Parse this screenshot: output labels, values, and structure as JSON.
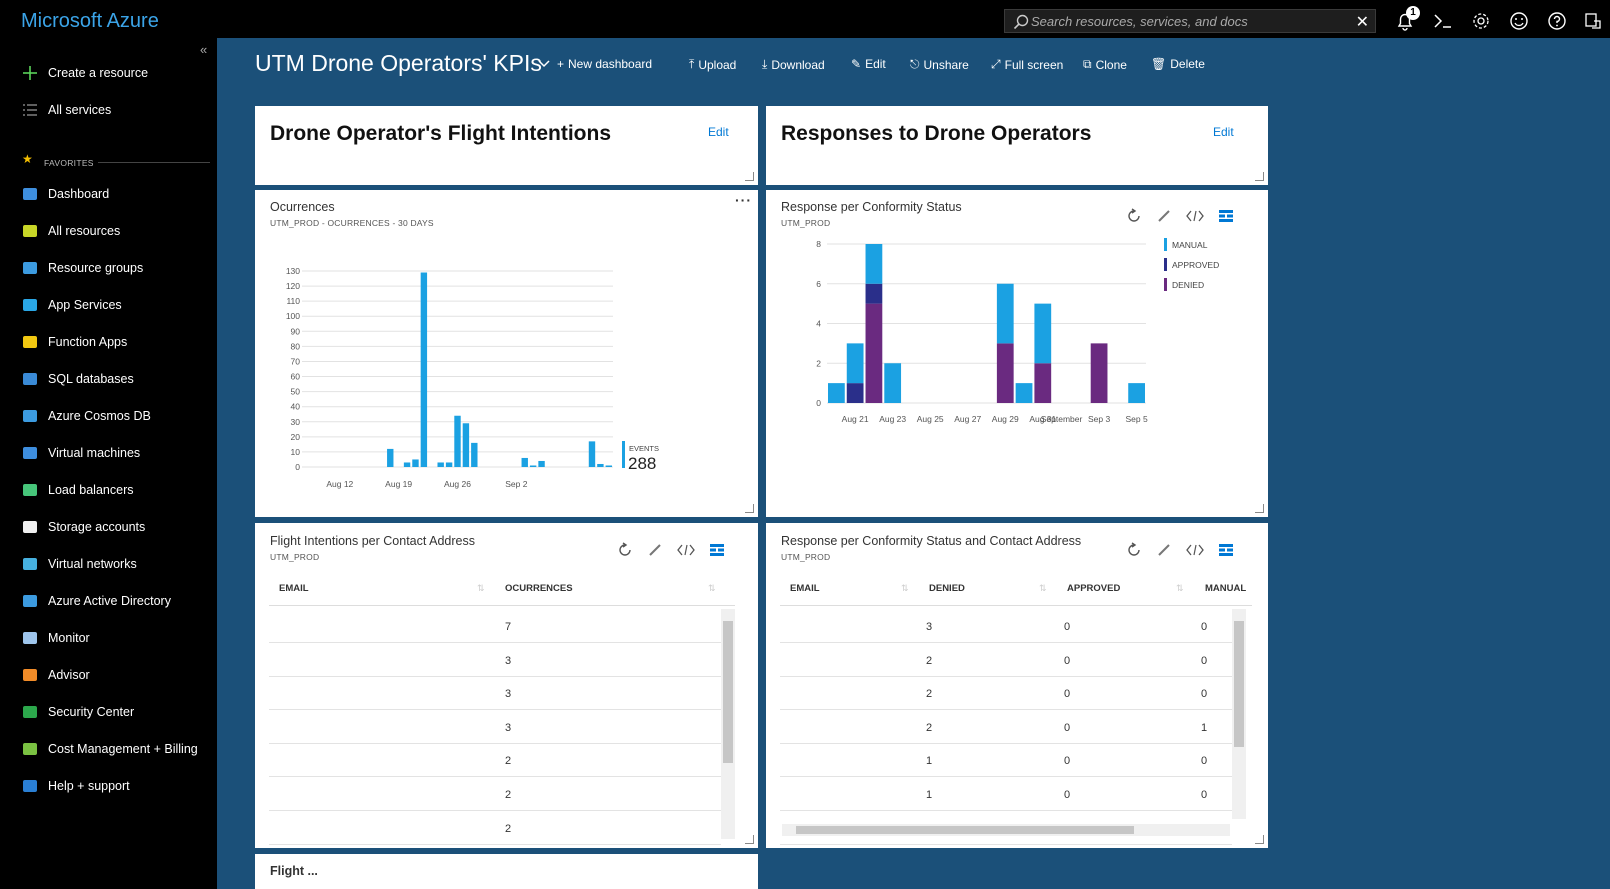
{
  "app": {
    "brand": "Microsoft Azure"
  },
  "topbar": {
    "search_placeholder": "Search resources, services, and docs",
    "notification_count": "1",
    "icons": [
      "bell-icon",
      "cloud-shell-icon",
      "settings-icon",
      "smiley-icon",
      "help-icon",
      "feedback-icon"
    ]
  },
  "sidebar": {
    "create": "Create a resource",
    "all_services": "All services",
    "favorites_label": "FAVORITES",
    "items": [
      {
        "label": "Dashboard",
        "icon": "dashboard-icon"
      },
      {
        "label": "All resources",
        "icon": "all-resources-icon"
      },
      {
        "label": "Resource groups",
        "icon": "resource-groups-icon"
      },
      {
        "label": "App Services",
        "icon": "app-services-icon"
      },
      {
        "label": "Function Apps",
        "icon": "function-apps-icon"
      },
      {
        "label": "SQL databases",
        "icon": "sql-databases-icon"
      },
      {
        "label": "Azure Cosmos DB",
        "icon": "cosmos-db-icon"
      },
      {
        "label": "Virtual machines",
        "icon": "virtual-machines-icon"
      },
      {
        "label": "Load balancers",
        "icon": "load-balancers-icon"
      },
      {
        "label": "Storage accounts",
        "icon": "storage-accounts-icon"
      },
      {
        "label": "Virtual networks",
        "icon": "virtual-networks-icon"
      },
      {
        "label": "Azure Active Directory",
        "icon": "active-directory-icon"
      },
      {
        "label": "Monitor",
        "icon": "monitor-icon"
      },
      {
        "label": "Advisor",
        "icon": "advisor-icon"
      },
      {
        "label": "Security Center",
        "icon": "security-center-icon"
      },
      {
        "label": "Cost Management + Billing",
        "icon": "cost-management-icon"
      },
      {
        "label": "Help + support",
        "icon": "help-support-icon"
      }
    ]
  },
  "dashboard": {
    "title": "UTM Drone Operators' KPIs",
    "toolbar": {
      "new_dashboard": "New dashboard",
      "upload": "Upload",
      "download": "Download",
      "edit": "Edit",
      "unshare": "Unshare",
      "full_screen": "Full screen",
      "clone": "Clone",
      "delete": "Delete"
    }
  },
  "tiles": {
    "md1": {
      "title": "Drone Operator's Flight Intentions",
      "edit": "Edit"
    },
    "md2": {
      "title": "Responses to Drone Operators",
      "edit": "Edit"
    },
    "occurrences": {
      "title": "Ocurrences",
      "subtitle": "UTM_PROD - OCURRENCES - 30 DAYS",
      "total_label": "EVENTS",
      "total": "288"
    },
    "conformity": {
      "title": "Response per Conformity Status",
      "subtitle": "UTM_PROD"
    },
    "contact": {
      "title": "Flight Intentions per Contact Address",
      "subtitle": "UTM_PROD",
      "headers": [
        "EMAIL",
        "OCURRENCES"
      ],
      "rows": [
        [
          "",
          "7"
        ],
        [
          "",
          "3"
        ],
        [
          "",
          "3"
        ],
        [
          "",
          "3"
        ],
        [
          "",
          "2"
        ],
        [
          "",
          "2"
        ],
        [
          "",
          "2"
        ]
      ]
    },
    "conformity_contact": {
      "title": "Response per Conformity Status and Contact Address",
      "subtitle": "UTM_PROD",
      "headers": [
        "EMAIL",
        "DENIED",
        "APPROVED",
        "MANUAL"
      ],
      "rows": [
        [
          "",
          "3",
          "0",
          "0"
        ],
        [
          "",
          "2",
          "0",
          "0"
        ],
        [
          "",
          "2",
          "0",
          "0"
        ],
        [
          "",
          "2",
          "0",
          "1"
        ],
        [
          "",
          "1",
          "0",
          "0"
        ],
        [
          "",
          "1",
          "0",
          "0"
        ],
        [
          "",
          "1",
          "0",
          "0"
        ]
      ]
    },
    "bottom": {
      "title": "Flight ..."
    }
  },
  "colors": {
    "accent": "#1ba1e2",
    "manual": "#1ba1e2",
    "approved": "#2a2f8a",
    "denied": "#6a2a80",
    "dashboard_bg": "#1b5079"
  },
  "chart_data": [
    {
      "type": "bar",
      "title": "Ocurrences",
      "subtitle": "UTM_PROD - OCURRENCES - 30 DAYS",
      "x_tick_labels": [
        "Aug 12",
        "Aug 19",
        "Aug 26",
        "Sep 2"
      ],
      "x_first": "Aug 8",
      "x_last": "Sep 9",
      "days": [
        "Aug 8",
        "Aug 9",
        "Aug 10",
        "Aug 11",
        "Aug 12",
        "Aug 13",
        "Aug 14",
        "Aug 15",
        "Aug 16",
        "Aug 17",
        "Aug 18",
        "Aug 19",
        "Aug 20",
        "Aug 21",
        "Aug 22",
        "Aug 23",
        "Aug 24",
        "Aug 25",
        "Aug 26",
        "Aug 27",
        "Aug 28",
        "Aug 29",
        "Aug 30",
        "Aug 31",
        "Sep 1",
        "Sep 2",
        "Sep 3",
        "Sep 4",
        "Sep 5",
        "Sep 6",
        "Sep 7",
        "Sep 8",
        "Sep 9"
      ],
      "values": [
        0,
        0,
        0,
        0,
        0,
        0,
        0,
        0,
        0,
        0,
        12,
        0,
        3,
        5,
        129,
        0,
        3,
        3,
        34,
        29,
        16,
        0,
        0,
        0,
        0,
        0,
        6,
        1,
        4,
        0,
        0,
        0,
        0,
        0,
        17,
        2,
        1
      ],
      "yticks": [
        0,
        10,
        20,
        30,
        40,
        50,
        60,
        70,
        80,
        90,
        100,
        110,
        120,
        130
      ],
      "ylim": [
        0,
        130
      ],
      "legend": {
        "label": "EVENTS",
        "value": "288"
      }
    },
    {
      "type": "bar",
      "stacked": true,
      "title": "Response per Conformity Status",
      "subtitle": "UTM_PROD",
      "x_tick_labels": [
        "Aug 21",
        "Aug 23",
        "Aug 25",
        "Aug 27",
        "Aug 29",
        "Aug 31",
        "September",
        "Sep 3",
        "Sep 5"
      ],
      "days": [
        "Aug 20",
        "Aug 21",
        "Aug 22",
        "Aug 23",
        "Aug 24",
        "Aug 25",
        "Aug 26",
        "Aug 27",
        "Aug 28",
        "Aug 29",
        "Aug 30",
        "Aug 31",
        "Sep 1",
        "Sep 2",
        "Sep 3",
        "Sep 4",
        "Sep 5"
      ],
      "series": [
        {
          "name": "DENIED",
          "values": [
            0,
            0,
            5,
            0,
            0,
            0,
            0,
            0,
            0,
            3,
            0,
            2,
            0,
            0,
            3,
            0,
            0
          ]
        },
        {
          "name": "APPROVED",
          "values": [
            0,
            1,
            1,
            0,
            0,
            0,
            0,
            0,
            0,
            0,
            0,
            0,
            0,
            0,
            0,
            0,
            0
          ]
        },
        {
          "name": "MANUAL",
          "values": [
            1,
            2,
            2,
            2,
            0,
            0,
            0,
            0,
            0,
            3,
            1,
            3,
            0,
            0,
            0,
            0,
            1
          ]
        }
      ],
      "yticks": [
        0,
        2,
        4,
        6,
        8
      ],
      "ylim": [
        0,
        8
      ],
      "legend_position": "right"
    }
  ]
}
